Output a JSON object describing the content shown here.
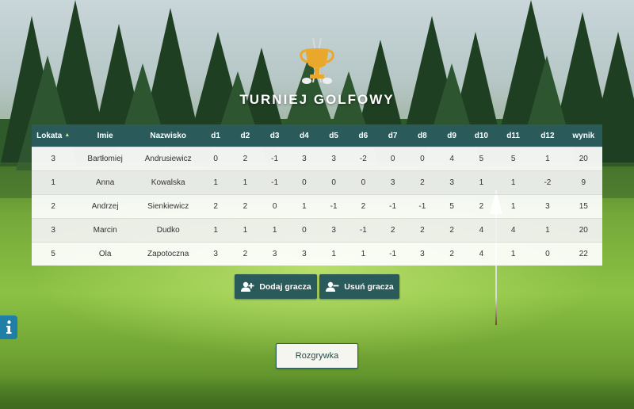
{
  "app": {
    "title": "TURNIEJ GOLFOWY"
  },
  "icons": {
    "logo": "golf-trophy-icon",
    "add": "user-plus-icon",
    "remove": "user-minus-icon",
    "info": "info-icon"
  },
  "colors": {
    "header_bg": "#2a5a5a",
    "button_bg": "#2b5a5a",
    "trophy_gold": "#e9a82b",
    "info_blue": "#1f7fa6"
  },
  "table": {
    "sorted_by": "Lokata",
    "sort_direction": "ascending",
    "headers": [
      "Lokata",
      "Imie",
      "Nazwisko",
      "d1",
      "d2",
      "d3",
      "d4",
      "d5",
      "d6",
      "d7",
      "d8",
      "d9",
      "d10",
      "d11",
      "d12",
      "wynik"
    ],
    "rows": [
      [
        "3",
        "Bartłomiej",
        "Andrusiewicz",
        "0",
        "2",
        "-1",
        "3",
        "3",
        "-2",
        "0",
        "0",
        "4",
        "5",
        "5",
        "1",
        "20"
      ],
      [
        "1",
        "Anna",
        "Kowalska",
        "1",
        "1",
        "-1",
        "0",
        "0",
        "0",
        "3",
        "2",
        "3",
        "1",
        "1",
        "-2",
        "9"
      ],
      [
        "2",
        "Andrzej",
        "Sienkiewicz",
        "2",
        "2",
        "0",
        "1",
        "-1",
        "2",
        "-1",
        "-1",
        "5",
        "2",
        "1",
        "3",
        "15"
      ],
      [
        "3",
        "Marcin",
        "Dudko",
        "1",
        "1",
        "1",
        "0",
        "3",
        "-1",
        "2",
        "2",
        "2",
        "4",
        "4",
        "1",
        "20"
      ],
      [
        "5",
        "Ola",
        "Zapotoczna",
        "3",
        "2",
        "3",
        "3",
        "1",
        "1",
        "-1",
        "3",
        "2",
        "4",
        "1",
        "0",
        "22"
      ]
    ]
  },
  "buttons": {
    "add": "Dodaj gracza",
    "remove": "Usuń gracza",
    "play": "Rozgrywka"
  }
}
